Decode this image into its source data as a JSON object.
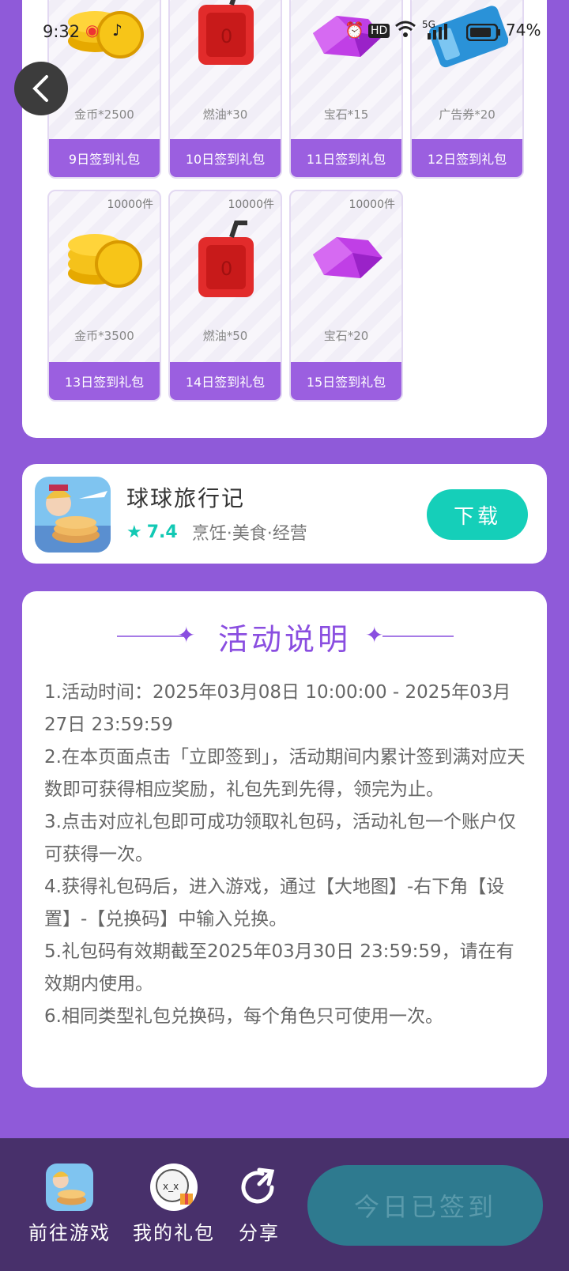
{
  "status_bar": {
    "time": "9:32",
    "battery": "74%",
    "network": "5G",
    "hd": "HD"
  },
  "rewards_row1": [
    {
      "name": "金币*2500",
      "label": "9日签到礼包"
    },
    {
      "name": "燃油*30",
      "label": "10日签到礼包"
    },
    {
      "name": "宝石*15",
      "label": "11日签到礼包"
    },
    {
      "name": "广告券*20",
      "label": "12日签到礼包"
    }
  ],
  "rewards_row2": [
    {
      "qty": "10000件",
      "name": "金币*3500",
      "label": "13日签到礼包"
    },
    {
      "qty": "10000件",
      "name": "燃油*50",
      "label": "14日签到礼包"
    },
    {
      "qty": "10000件",
      "name": "宝石*20",
      "label": "15日签到礼包"
    }
  ],
  "game": {
    "name": "球球旅行记",
    "rating": "7.4",
    "tags": "烹饪·美食·经营",
    "download_label": "下载"
  },
  "rules": {
    "title": "活动说明",
    "items": [
      "1.活动时间：2025年03月08日 10:00:00 - 2025年03月27日 23:59:59",
      "2.在本页面点击「立即签到」，活动期间内累计签到满对应天数即可获得相应奖励，礼包先到先得，领完为止。",
      "3.点击对应礼包即可成功领取礼包码，活动礼包一个账户仅可获得一次。",
      "4.获得礼包码后，进入游戏，通过【大地图】-右下角【设置】-【兑换码】中输入兑换。",
      "5.礼包码有效期截至2025年03月30日 23:59:59，请在有效期内使用。",
      "6.相同类型礼包兑换码，每个角色只可使用一次。"
    ]
  },
  "bottom_bar": {
    "goto_game": "前往游戏",
    "my_gifts": "我的礼包",
    "share": "分享",
    "checked_in": "今日已签到"
  },
  "colors": {
    "background": "#8f5ad9",
    "accent": "#9b5fe0",
    "teal": "#15cfb9",
    "bottom": "#48306b"
  }
}
